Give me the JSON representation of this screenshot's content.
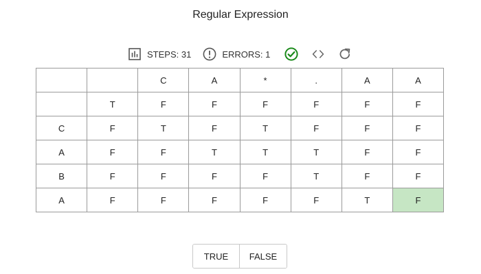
{
  "title": "Regular Expression",
  "toolbar": {
    "steps_label": "STEPS: 31",
    "errors_label": "ERRORS: 1",
    "icons": {
      "steps": "bar-chart-icon",
      "errors": "exclamation-circle-icon",
      "check": "check-circle-icon",
      "code": "code-brackets-icon",
      "reset": "refresh-icon"
    },
    "check_color": "#1a8a1a"
  },
  "grid": {
    "rows": [
      [
        "",
        "",
        "C",
        "A",
        "*",
        ".",
        "A",
        "A"
      ],
      [
        "",
        "T",
        "F",
        "F",
        "F",
        "F",
        "F",
        "F"
      ],
      [
        "C",
        "F",
        "T",
        "F",
        "T",
        "F",
        "F",
        "F"
      ],
      [
        "A",
        "F",
        "F",
        "T",
        "T",
        "T",
        "F",
        "F"
      ],
      [
        "B",
        "F",
        "F",
        "F",
        "F",
        "T",
        "F",
        "F"
      ],
      [
        "A",
        "F",
        "F",
        "F",
        "F",
        "F",
        "T",
        "F"
      ]
    ],
    "highlight_cell": {
      "row": 5,
      "col": 7
    },
    "highlight_color": "#c6e6c4"
  },
  "answer": {
    "true_label": "TRUE",
    "false_label": "FALSE"
  }
}
